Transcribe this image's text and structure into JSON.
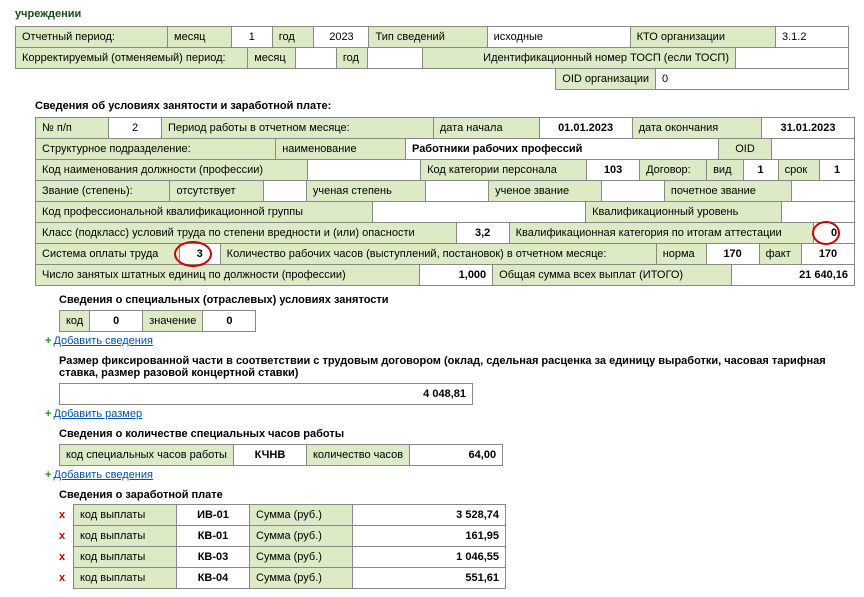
{
  "header_title": "учреждении",
  "periods": {
    "otch_period_lbl": "Отчетный период:",
    "month_lbl": "месяц",
    "month_val": "1",
    "year_lbl": "год",
    "year_val": "2023",
    "tip_lbl": "Тип сведений",
    "tip_val": "исходные",
    "kto_lbl": "КТО организации",
    "kto_val": "3.1.2",
    "korr_lbl": "Корректируемый (отменяемый) период:",
    "korr_month_lbl": "месяц",
    "korr_month_val": "",
    "korr_year_lbl": "год",
    "korr_year_val": "",
    "tosp_lbl": "Идентификационный номер ТОСП (если ТОСП)",
    "tosp_val": "",
    "oid_org_lbl": "OID организации",
    "oid_org_val": "0"
  },
  "section1_title": "Сведения об условиях занятости и заработной плате:",
  "r1": {
    "npp_lbl": "№ п/п",
    "npp_val": "2",
    "period_lbl": "Период работы в отчетном месяце:",
    "dn_lbl": "дата начала",
    "dn_val": "01.01.2023",
    "do": "дата окончания",
    "do_val": "31.01.2023"
  },
  "r2": {
    "struct_lbl": "Структурное подразделение:",
    "naim_lbl": "наименование",
    "naim_val": "Работники рабочих профессий",
    "oid_lbl": "OID",
    "oid_val": ""
  },
  "r3": {
    "kod_naim_lbl": "Код наименования должности (профессии)",
    "kod_naim_val": "",
    "kod_kat_lbl": "Код категории персонала",
    "kod_kat_val": "103",
    "dog_lbl": "Договор:",
    "vid_lbl": "вид",
    "vid_val": "1",
    "srok_lbl": "срок",
    "srok_val": "1"
  },
  "r4": {
    "zvanie_lbl": "Звание (степень):",
    "ots_lbl": "отсутствует",
    "ots_val": "",
    "uch_step_lbl": "ученая степень",
    "uch_step_val": "",
    "uch_zv_lbl": "ученое звание",
    "uch_zv_val": "",
    "poch_lbl": "почетное звание",
    "poch_val": ""
  },
  "r5": {
    "kod_prof_lbl": "Код профессиональной квалификационной группы",
    "kod_prof_val": "",
    "kval_ur_lbl": "Квалификационный уровень",
    "kval_ur_val": ""
  },
  "r6": {
    "klass_lbl": "Класс (подкласс) условий труда по степени вредности и (или) опасности",
    "klass_val": "3,2",
    "kval_kat_lbl": "Квалификационная категория по итогам аттестации",
    "kval_kat_val": "0"
  },
  "r7": {
    "sys_lbl": "Система оплаты труда",
    "sys_val": "3",
    "hours_lbl": "Количество рабочих часов (выступлений, постановок) в отчетном месяце:",
    "norma_lbl": "норма",
    "norma_val": "170",
    "fakt_lbl": "факт",
    "fakt_val": "170"
  },
  "r8": {
    "num_lbl": "Число занятых штатных единиц по должности (профессии)",
    "num_val": "1,000",
    "sum_lbl": "Общая сумма всех выплат (ИТОГО)",
    "sum_val": "21 640,16"
  },
  "spec": {
    "title": "Сведения о специальных (отраслевых) условиях занятости",
    "kod_lbl": "код",
    "kod_val": "0",
    "zn_lbl": "значение",
    "zn_val": "0",
    "add": "Добавить сведения"
  },
  "fix": {
    "title": "Размер фиксированной части в соответствии с трудовым договором (оклад, сдельная расценка за единицу выработки, часовая тарифная ставка, размер разовой концертной ставки)",
    "val": "4 048,81",
    "add": "Добавить размер"
  },
  "hours": {
    "title": "Сведения о количестве специальных часов работы",
    "kod_lbl": "код специальных часов работы",
    "kod_val": "КЧНВ",
    "count_lbl": "количество часов",
    "count_val": "64,00",
    "add": "Добавить сведения"
  },
  "pay": {
    "title": "Сведения о заработной плате",
    "rows": [
      {
        "kod_lbl": "код выплаты",
        "kod": "ИВ-01",
        "sum_lbl": "Сумма (руб.)",
        "sum": "3 528,74"
      },
      {
        "kod_lbl": "код выплаты",
        "kod": "КВ-01",
        "sum_lbl": "Сумма (руб.)",
        "sum": "161,95"
      },
      {
        "kod_lbl": "код выплаты",
        "kod": "КВ-03",
        "sum_lbl": "Сумма (руб.)",
        "sum": "1 046,55"
      },
      {
        "kod_lbl": "код выплаты",
        "kod": "КВ-04",
        "sum_lbl": "Сумма (руб.)",
        "sum": "551,61"
      }
    ]
  }
}
